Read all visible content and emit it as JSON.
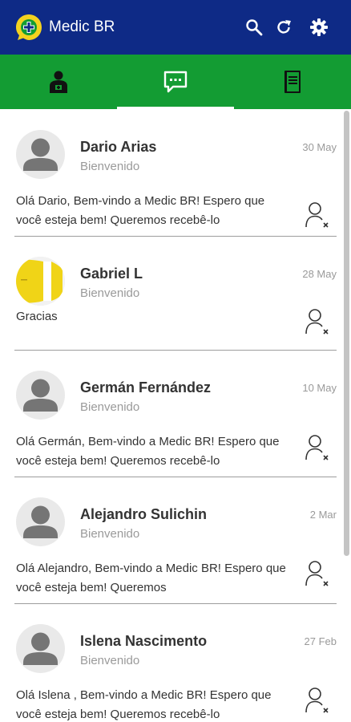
{
  "app": {
    "title": "Medic BR",
    "colors": {
      "appbar": "#0e2a86",
      "tabbar": "#139c33",
      "logo_yellow": "#f4d21f"
    }
  },
  "header": {
    "actions": [
      {
        "icon": "search-icon"
      },
      {
        "icon": "refresh-icon"
      },
      {
        "icon": "settings-gear-icon"
      }
    ]
  },
  "tabs": [
    {
      "icon": "doctor-icon",
      "selected": false
    },
    {
      "icon": "chat-icon",
      "selected": true
    },
    {
      "icon": "notebook-icon",
      "selected": false
    }
  ],
  "conversations": [
    {
      "name": "Dario Arias",
      "subtitle": "Bienvenido",
      "date": "30 May",
      "preview": "Olá Dario, Bem-vindo a Medic BR! Espero que você esteja bem! Queremos recebê-lo",
      "avatar": "default"
    },
    {
      "name": "Gabriel L",
      "subtitle": "Bienvenido",
      "date": "28 May",
      "preview": "Gracias",
      "avatar": "photo"
    },
    {
      "name": "Germán Fernández",
      "subtitle": "Bienvenido",
      "date": "10 May",
      "preview": "Olá Germán, Bem-vindo a Medic BR! Espero que você esteja bem! Queremos recebê-lo",
      "avatar": "default"
    },
    {
      "name": "Alejandro Sulichin",
      "subtitle": "Bienvenido",
      "date": "2 Mar",
      "preview": "Olá Alejandro, Bem-vindo a Medic BR! Espero que você esteja bem! Queremos",
      "avatar": "default"
    },
    {
      "name": "Islena Nascimento",
      "subtitle": "Bienvenido",
      "date": "27 Feb",
      "preview": "Olá Islena , Bem-vindo a Medic BR! Espero que você esteja bem! Queremos recebê-lo",
      "avatar": "default"
    }
  ]
}
